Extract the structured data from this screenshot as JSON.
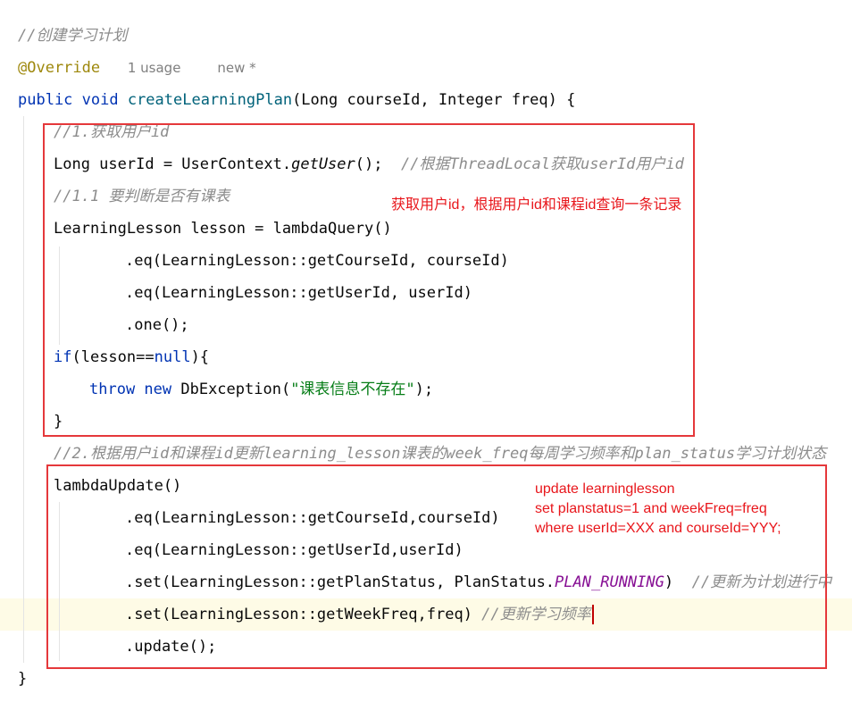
{
  "editor": {
    "lines": [
      {
        "indent": 20,
        "tokens": [
          {
            "t": "//创建学习计划",
            "c": "cmt"
          }
        ]
      },
      {
        "indent": 20,
        "tokens": [
          {
            "t": "@Override",
            "c": "ann"
          },
          {
            "t": "   ",
            "c": ""
          },
          {
            "t": "1 usage",
            "c": "meta"
          },
          {
            "t": "    ",
            "c": ""
          },
          {
            "t": "new *",
            "c": "meta"
          }
        ]
      },
      {
        "indent": 20,
        "tokens": [
          {
            "t": "public void ",
            "c": "kw"
          },
          {
            "t": "createLearningPlan",
            "c": "fn"
          },
          {
            "t": "(Long courseId, Integer freq) {",
            "c": ""
          }
        ]
      },
      {
        "indent": 60,
        "tokens": [
          {
            "t": "//1.获取用户id",
            "c": "cmt"
          }
        ]
      },
      {
        "indent": 60,
        "tokens": [
          {
            "t": "Long userId = UserContext.",
            "c": ""
          },
          {
            "t": "getUser",
            "c": "itl"
          },
          {
            "t": "();  ",
            "c": ""
          },
          {
            "t": "//根据ThreadLocal获取userId用户id",
            "c": "cmt"
          }
        ]
      },
      {
        "indent": 60,
        "tokens": [
          {
            "t": "//1.1 要判断是否有课表",
            "c": "cmt"
          }
        ]
      },
      {
        "indent": 60,
        "tokens": [
          {
            "t": "LearningLesson lesson = lambdaQuery()",
            "c": ""
          }
        ]
      },
      {
        "indent": 140,
        "tokens": [
          {
            "t": ".eq(LearningLesson::getCourseId, courseId)",
            "c": ""
          }
        ]
      },
      {
        "indent": 140,
        "tokens": [
          {
            "t": ".eq(LearningLesson::getUserId, userId)",
            "c": ""
          }
        ]
      },
      {
        "indent": 140,
        "tokens": [
          {
            "t": ".one();",
            "c": ""
          }
        ]
      },
      {
        "indent": 60,
        "tokens": [
          {
            "t": "if",
            "c": "kw"
          },
          {
            "t": "(lesson==",
            "c": ""
          },
          {
            "t": "null",
            "c": "kw"
          },
          {
            "t": "){",
            "c": ""
          }
        ]
      },
      {
        "indent": 100,
        "tokens": [
          {
            "t": "throw new ",
            "c": "kw"
          },
          {
            "t": "DbException(",
            "c": ""
          },
          {
            "t": "\"课表信息不存在\"",
            "c": "str"
          },
          {
            "t": ");",
            "c": ""
          }
        ]
      },
      {
        "indent": 60,
        "tokens": [
          {
            "t": "}",
            "c": ""
          }
        ]
      },
      {
        "indent": 60,
        "tokens": [
          {
            "t": "//2.根据用户id和课程id更新learning_lesson课表的week_freq每周学习频率和plan_status学习计划状态",
            "c": "cmt"
          }
        ]
      },
      {
        "indent": 60,
        "tokens": [
          {
            "t": "lambdaUpdate()",
            "c": ""
          }
        ]
      },
      {
        "indent": 140,
        "tokens": [
          {
            "t": ".eq(LearningLesson::getCourseId,courseId)",
            "c": ""
          }
        ]
      },
      {
        "indent": 140,
        "tokens": [
          {
            "t": ".eq(LearningLesson::getUserId,userId)",
            "c": ""
          }
        ]
      },
      {
        "indent": 140,
        "tokens": [
          {
            "t": ".set(LearningLesson::getPlanStatus, PlanStatus.",
            "c": ""
          },
          {
            "t": "PLAN_RUNNING",
            "c": "cst"
          },
          {
            "t": ")  ",
            "c": ""
          },
          {
            "t": "//更新为计划进行中",
            "c": "cmt"
          }
        ]
      },
      {
        "indent": 140,
        "tokens": [
          {
            "t": ".set(LearningLesson::getWeekFreq,freq) ",
            "c": ""
          },
          {
            "t": "//更新学习频率",
            "c": "cmt"
          }
        ],
        "current": true
      },
      {
        "indent": 140,
        "tokens": [
          {
            "t": ".update();",
            "c": ""
          }
        ]
      },
      {
        "indent": 20,
        "tokens": [
          {
            "t": "}",
            "c": ""
          }
        ]
      }
    ]
  },
  "annotations": {
    "box1_note": "获取用户id，根据用户id和课程id查询一条记录",
    "box2_note": "update learninglesson\nset planstatus=1 and weekFreq=freq\nwhere userId=XXX and courseId=YYY;",
    "box_color": "#e5383b",
    "text_color": "#e8161b"
  }
}
